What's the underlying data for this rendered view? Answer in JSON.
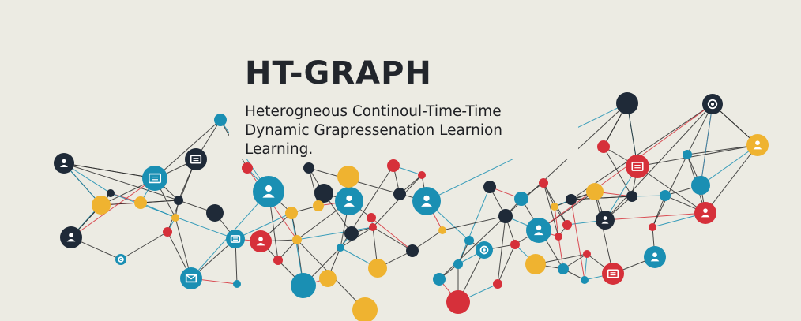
{
  "title": "HT-GRAPH",
  "subtitle_lines": [
    "Heterogneous Continoul-Time-Time",
    "Dynamic Grapressenation Learnion",
    "Learning."
  ],
  "colors": {
    "background": "#ecebe3",
    "teal": "#1a8fb3",
    "red": "#d6303a",
    "yellow": "#efb330",
    "navy": "#1f2a38",
    "edge": "#2b2b2b"
  },
  "graph": {
    "node_color_palette": [
      "teal",
      "red",
      "yellow",
      "navy"
    ],
    "edge_color_palette": [
      "edge",
      "teal",
      "red"
    ]
  }
}
